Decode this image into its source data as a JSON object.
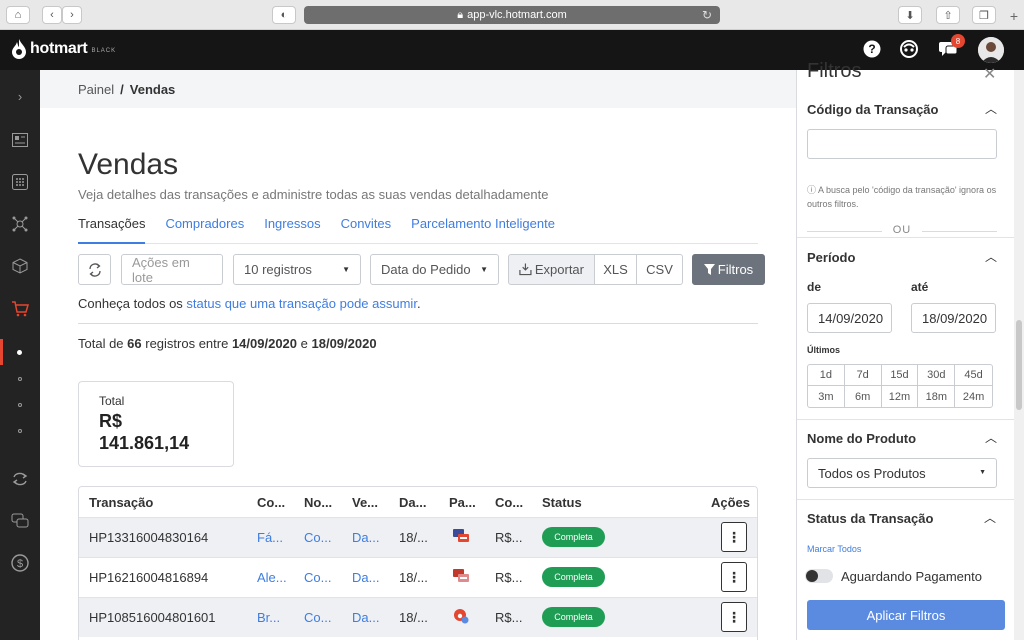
{
  "browser": {
    "url": "app-vlc.hotmart.com"
  },
  "topbar": {
    "brand": "hotmart",
    "brand_sub": "BLACK",
    "notifications": "8"
  },
  "breadcrumb": {
    "parent": "Painel",
    "sep": "/",
    "current": "Vendas"
  },
  "page": {
    "title": "Vendas",
    "description": "Veja detalhes das transações e administre todas as suas vendas detalhadamente"
  },
  "tabs": [
    "Transações",
    "Compradores",
    "Ingressos",
    "Convites",
    "Parcelamento Inteligente"
  ],
  "toolbar": {
    "actions": "Ações em lote",
    "per_page": "10 registros",
    "order": "Data do Pedido",
    "export": "Exportar",
    "xls": "XLS",
    "csv": "CSV",
    "filters": "Filtros"
  },
  "status_info": {
    "prefix": "Conheça todos os ",
    "link": "status que uma transação pode assumir",
    "suffix": "."
  },
  "summary": {
    "prefix": "Total de ",
    "count": "66",
    "middle": " registros entre ",
    "start": "14/09/2020",
    "and": " e ",
    "end": "18/09/2020"
  },
  "total_card": {
    "label": "Total",
    "currency": "R$",
    "value": "141.861,14"
  },
  "table": {
    "headers": [
      "Transação",
      "Co...",
      "No...",
      "Ve...",
      "Da...",
      "Pa...",
      "Co...",
      "Status",
      "Ações"
    ],
    "rows": [
      {
        "id": "HP13316004830164",
        "c1": "Fá...",
        "c2": "Co...",
        "c3": "Da...",
        "date": "18/...",
        "value": "R$...",
        "status": "Completa"
      },
      {
        "id": "HP16216004816894",
        "c1": "Ale...",
        "c2": "Co...",
        "c3": "Da...",
        "date": "18/...",
        "value": "R$...",
        "status": "Completa"
      },
      {
        "id": "HP108516004801601",
        "c1": "Br...",
        "c2": "Co...",
        "c3": "Da...",
        "date": "18/...",
        "value": "R$...",
        "status": "Completa"
      }
    ]
  },
  "filters": {
    "title": "Filtros",
    "transaction_code": {
      "title": "Código da Transação",
      "hint": "A busca pelo 'código da transação' ignora os outros filtros.",
      "or": "OU"
    },
    "period": {
      "title": "Período",
      "from_label": "de",
      "to_label": "até",
      "from": "14/09/2020",
      "to": "18/09/2020",
      "last_label": "Últimos",
      "quick": [
        "1d",
        "7d",
        "15d",
        "30d",
        "45d",
        "3m",
        "6m",
        "12m",
        "18m",
        "24m"
      ]
    },
    "product": {
      "title": "Nome do Produto",
      "selected": "Todos os Produtos"
    },
    "status": {
      "title": "Status da Transação",
      "mark_all": "Marcar Todos",
      "first_option": "Aguardando Pagamento"
    },
    "apply": "Aplicar Filtros"
  },
  "colors": {
    "accent": "#3f7de0",
    "brand": "#e5462f",
    "success": "#1f9d55",
    "apply": "#5b8be0"
  }
}
